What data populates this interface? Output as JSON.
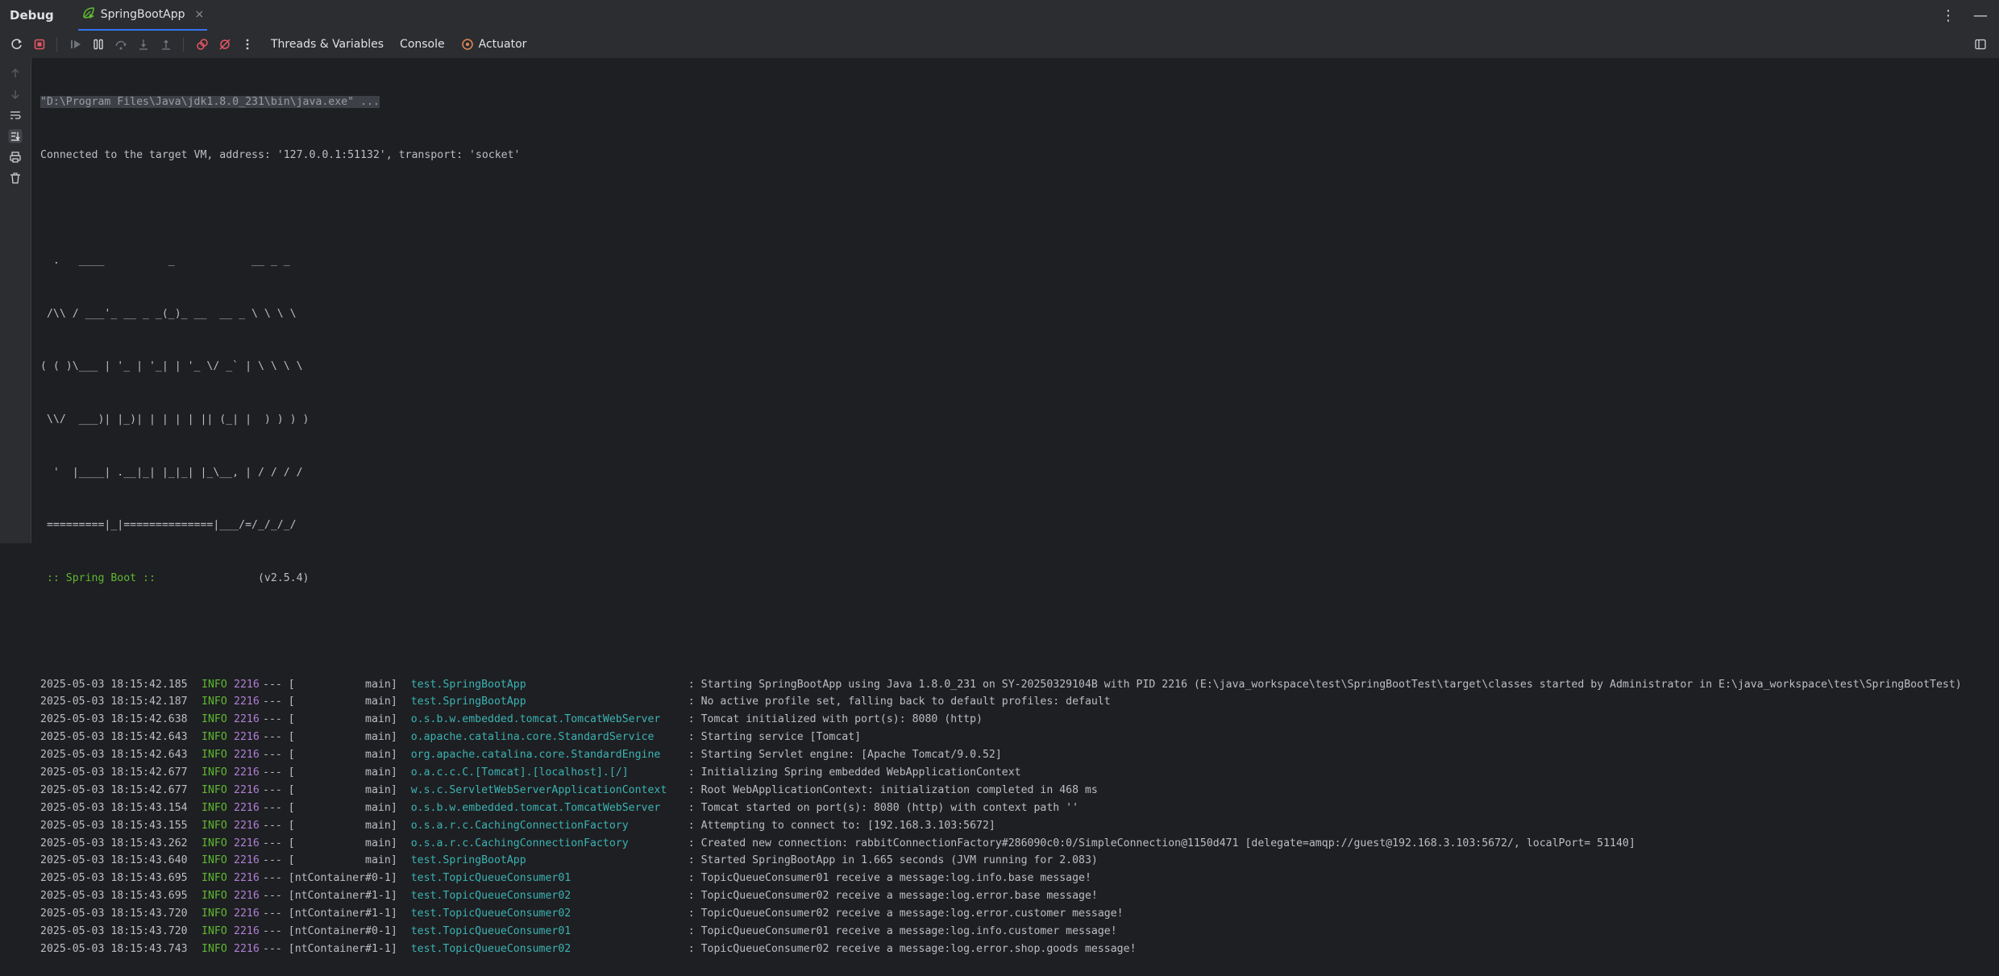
{
  "titlebar": {
    "title": "Debug",
    "tab_label": "SpringBootApp",
    "tab_close": "×",
    "more": "⋮",
    "minimize": "—"
  },
  "toolbar": {
    "tabs": [
      "Threads & Variables",
      "Console",
      "Actuator"
    ]
  },
  "console": {
    "cmd": "\"D:\\Program Files\\Java\\jdk1.8.0_231\\bin\\java.exe\" ...",
    "connected": "Connected to the target VM, address: '127.0.0.1:51132', transport: 'socket'",
    "banner": [
      "  .   ____          _            __ _ _",
      " /\\\\ / ___'_ __ _ _(_)_ __  __ _ \\ \\ \\ \\",
      "( ( )\\___ | '_ | '_| | '_ \\/ _` | \\ \\ \\ \\",
      " \\\\/  ___)| |_)| | | | | || (_| |  ) ) ) )",
      "  '  |____| .__|_| |_|_| |_\\__, | / / / /",
      " =========|_|==============|___/=/_/_/_/"
    ],
    "spring_boot_label": " :: Spring Boot :: ",
    "spring_boot_version": "               (v2.5.4)",
    "logs": [
      {
        "ts": "2025-05-03 18:15:42.185",
        "level": "INFO",
        "pid": "2216",
        "sep": "---",
        "thread": "[           main]",
        "logger": "test.SpringBootApp",
        "msg": ": Starting SpringBootApp using Java 1.8.0_231 on SY-20250329104B with PID 2216 (E:\\java_workspace\\test\\SpringBootTest\\target\\classes started by Administrator in E:\\java_workspace\\test\\SpringBootTest)"
      },
      {
        "ts": "2025-05-03 18:15:42.187",
        "level": "INFO",
        "pid": "2216",
        "sep": "---",
        "thread": "[           main]",
        "logger": "test.SpringBootApp",
        "msg": ": No active profile set, falling back to default profiles: default"
      },
      {
        "ts": "2025-05-03 18:15:42.638",
        "level": "INFO",
        "pid": "2216",
        "sep": "---",
        "thread": "[           main]",
        "logger": "o.s.b.w.embedded.tomcat.TomcatWebServer",
        "msg": ": Tomcat initialized with port(s): 8080 (http)"
      },
      {
        "ts": "2025-05-03 18:15:42.643",
        "level": "INFO",
        "pid": "2216",
        "sep": "---",
        "thread": "[           main]",
        "logger": "o.apache.catalina.core.StandardService",
        "msg": ": Starting service [Tomcat]"
      },
      {
        "ts": "2025-05-03 18:15:42.643",
        "level": "INFO",
        "pid": "2216",
        "sep": "---",
        "thread": "[           main]",
        "logger": "org.apache.catalina.core.StandardEngine",
        "msg": ": Starting Servlet engine: [Apache Tomcat/9.0.52]"
      },
      {
        "ts": "2025-05-03 18:15:42.677",
        "level": "INFO",
        "pid": "2216",
        "sep": "---",
        "thread": "[           main]",
        "logger": "o.a.c.c.C.[Tomcat].[localhost].[/]",
        "msg": ": Initializing Spring embedded WebApplicationContext"
      },
      {
        "ts": "2025-05-03 18:15:42.677",
        "level": "INFO",
        "pid": "2216",
        "sep": "---",
        "thread": "[           main]",
        "logger": "w.s.c.ServletWebServerApplicationContext",
        "msg": ": Root WebApplicationContext: initialization completed in 468 ms"
      },
      {
        "ts": "2025-05-03 18:15:43.154",
        "level": "INFO",
        "pid": "2216",
        "sep": "---",
        "thread": "[           main]",
        "logger": "o.s.b.w.embedded.tomcat.TomcatWebServer",
        "msg": ": Tomcat started on port(s): 8080 (http) with context path ''"
      },
      {
        "ts": "2025-05-03 18:15:43.155",
        "level": "INFO",
        "pid": "2216",
        "sep": "---",
        "thread": "[           main]",
        "logger": "o.s.a.r.c.CachingConnectionFactory",
        "msg": ": Attempting to connect to: [192.168.3.103:5672]"
      },
      {
        "ts": "2025-05-03 18:15:43.262",
        "level": "INFO",
        "pid": "2216",
        "sep": "---",
        "thread": "[           main]",
        "logger": "o.s.a.r.c.CachingConnectionFactory",
        "msg": ": Created new connection: rabbitConnectionFactory#286090c0:0/SimpleConnection@1150d471 [delegate=amqp://guest@192.168.3.103:5672/, localPort= 51140]"
      },
      {
        "ts": "2025-05-03 18:15:43.640",
        "level": "INFO",
        "pid": "2216",
        "sep": "---",
        "thread": "[           main]",
        "logger": "test.SpringBootApp",
        "msg": ": Started SpringBootApp in 1.665 seconds (JVM running for 2.083)"
      },
      {
        "ts": "2025-05-03 18:15:43.695",
        "level": "INFO",
        "pid": "2216",
        "sep": "---",
        "thread": "[ntContainer#0-1]",
        "logger": "test.TopicQueueConsumer01",
        "msg": ": TopicQueueConsumer01 receive a message:log.info.base message!"
      },
      {
        "ts": "2025-05-03 18:15:43.695",
        "level": "INFO",
        "pid": "2216",
        "sep": "---",
        "thread": "[ntContainer#1-1]",
        "logger": "test.TopicQueueConsumer02",
        "msg": ": TopicQueueConsumer02 receive a message:log.error.base message!"
      },
      {
        "ts": "2025-05-03 18:15:43.720",
        "level": "INFO",
        "pid": "2216",
        "sep": "---",
        "thread": "[ntContainer#1-1]",
        "logger": "test.TopicQueueConsumer02",
        "msg": ": TopicQueueConsumer02 receive a message:log.error.customer message!"
      },
      {
        "ts": "2025-05-03 18:15:43.720",
        "level": "INFO",
        "pid": "2216",
        "sep": "---",
        "thread": "[ntContainer#0-1]",
        "logger": "test.TopicQueueConsumer01",
        "msg": ": TopicQueueConsumer01 receive a message:log.info.customer message!"
      },
      {
        "ts": "2025-05-03 18:15:43.743",
        "level": "INFO",
        "pid": "2216",
        "sep": "---",
        "thread": "[ntContainer#1-1]",
        "logger": "test.TopicQueueConsumer02",
        "msg": ": TopicQueueConsumer02 receive a message:log.error.shop.goods message!"
      }
    ]
  },
  "colors": {
    "background": "#1e1f22",
    "panel": "#2b2d30",
    "info": "#5fb832",
    "pid": "#b07fd6",
    "logger": "#3bb3b3",
    "accent": "#3574f0"
  },
  "icons": {
    "titlebar": [
      "spring-run-icon",
      "more-vert-icon",
      "minimize-icon"
    ],
    "toolbar": [
      "rerun-icon",
      "stop-icon",
      "resume-icon",
      "pause-icon",
      "step-over-icon",
      "step-into-icon",
      "step-out-icon",
      "view-breakpoints-icon",
      "mute-breakpoints-icon",
      "more-vert-icon",
      "actuator-icon",
      "layout-icon"
    ],
    "gutter": [
      "scroll-up-icon",
      "scroll-down-icon",
      "soft-wrap-icon",
      "scroll-to-end-icon",
      "print-icon",
      "clear-all-icon"
    ]
  }
}
